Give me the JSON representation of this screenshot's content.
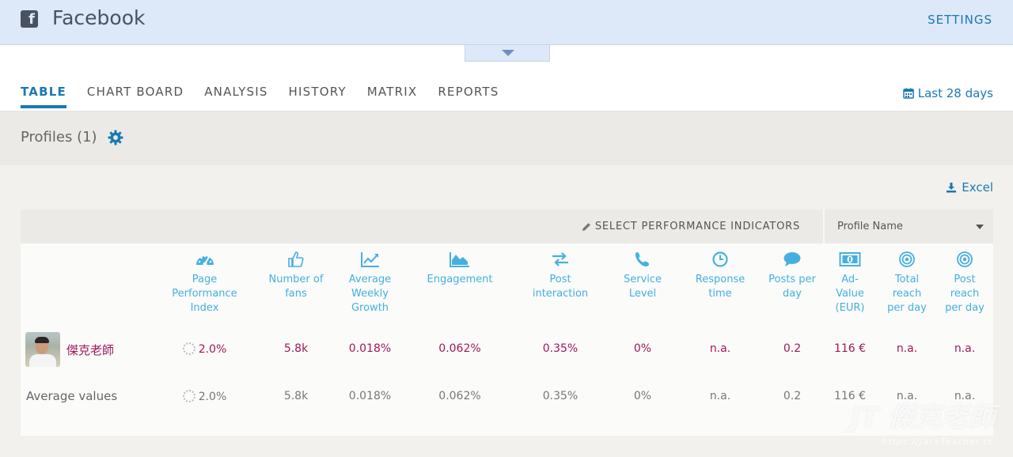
{
  "header": {
    "title": "Facebook",
    "settings_label": "SETTINGS",
    "logo_glyph": "f"
  },
  "tabs": [
    {
      "label": "TABLE",
      "active": true
    },
    {
      "label": "CHART BOARD",
      "active": false
    },
    {
      "label": "ANALYSIS",
      "active": false
    },
    {
      "label": "HISTORY",
      "active": false
    },
    {
      "label": "MATRIX",
      "active": false
    },
    {
      "label": "REPORTS",
      "active": false
    }
  ],
  "date_range": "Last 28 days",
  "profiles": {
    "title": "Profiles (1)"
  },
  "export": {
    "excel_label": "Excel"
  },
  "table": {
    "select_kpi_label": "SELECT PERFORMANCE INDICATORS",
    "sort_select_value": "Profile Name",
    "columns": [
      {
        "label": "Page Performance Index",
        "icon": "speedometer-icon"
      },
      {
        "label": "Number of fans",
        "icon": "thumbs-up-icon"
      },
      {
        "label": "Average Weekly Growth",
        "icon": "trend-chart-icon"
      },
      {
        "label": "Engagement",
        "icon": "area-chart-icon"
      },
      {
        "label": "Post interaction",
        "icon": "swap-arrows-icon"
      },
      {
        "label": "Service Level",
        "icon": "phone-icon"
      },
      {
        "label": "Response time",
        "icon": "clock-icon"
      },
      {
        "label": "Posts per day",
        "icon": "speech-bubble-icon"
      },
      {
        "label": "Ad-Value (EUR)",
        "icon": "money-icon"
      },
      {
        "label": "Total reach per day",
        "icon": "target-icon"
      },
      {
        "label": "Post reach per day",
        "icon": "target-icon"
      }
    ],
    "rows": [
      {
        "name": "傑克老師",
        "values": [
          "2.0%",
          "5.8k",
          "0.018%",
          "0.062%",
          "0.35%",
          "0%",
          "n.a.",
          "0.2",
          "116 €",
          "n.a.",
          "n.a."
        ]
      }
    ],
    "average": {
      "label": "Average values",
      "values": [
        "2.0%",
        "5.8k",
        "0.018%",
        "0.062%",
        "0.35%",
        "0%",
        "n.a.",
        "0.2",
        "116 €",
        "n.a.",
        "n.a."
      ]
    }
  },
  "watermark": {
    "text": "JT 傑克老師",
    "url": "https://JackTeacher.cc"
  },
  "colors": {
    "accent": "#1a78b4",
    "header_bg": "#dde8f8",
    "value": "#a0185a",
    "icon": "#45b0e0"
  }
}
